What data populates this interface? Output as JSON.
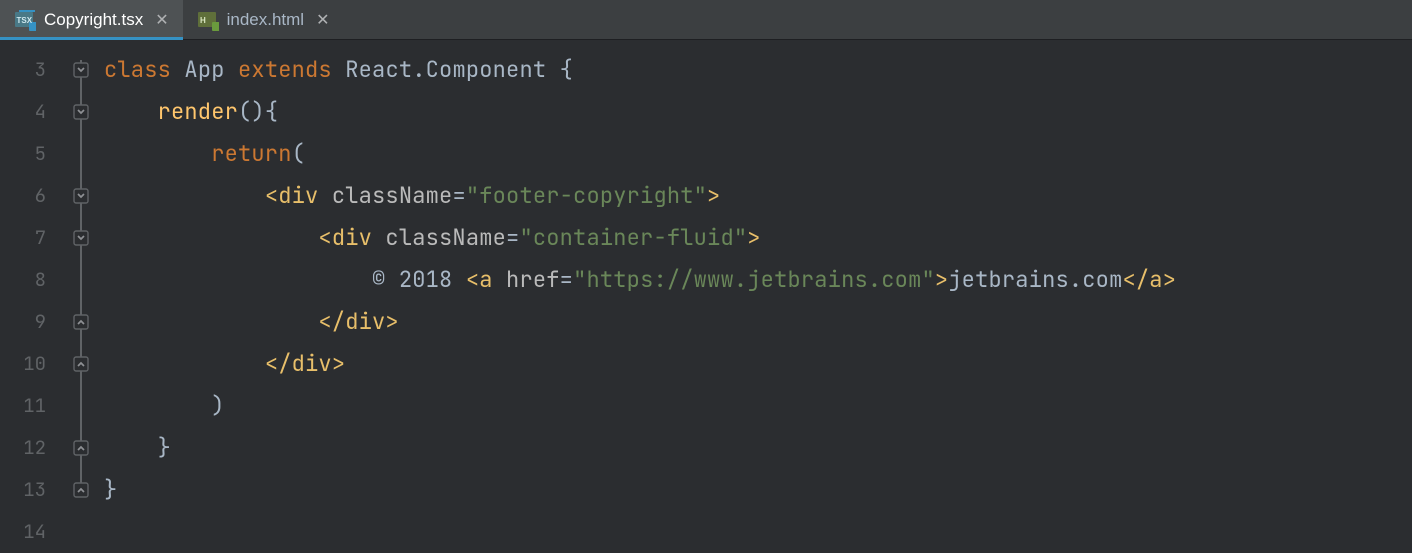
{
  "tabs": [
    {
      "label": "Copyright.tsx",
      "icon": "tsx",
      "active": true
    },
    {
      "label": "index.html",
      "icon": "html",
      "active": false
    }
  ],
  "gutter": [
    "3",
    "4",
    "5",
    "6",
    "7",
    "8",
    "9",
    "10",
    "11",
    "12",
    "13",
    "14"
  ],
  "tokens": {
    "class_kw": "class",
    "app": "App",
    "extends_kw": "extends",
    "react_comp": "React.Component",
    "brace_open": "{",
    "render": "render",
    "paren_empty": "()",
    "brace_open2": "{",
    "return_kw": "return",
    "paren_open": "(",
    "lt": "<",
    "div": "div",
    "className": "className",
    "eq": "=",
    "footer_copyright": "\"footer-copyright\"",
    "gt": ">",
    "container_fluid": "\"container-fluid\"",
    "copy_text": "© 2018 ",
    "a": "a",
    "href": "href",
    "href_val": "\"https://www.jetbrains.com\"",
    "jb": "jetbrains.com",
    "ltslash": "</",
    "paren_close": ")",
    "brace_close": "}"
  }
}
